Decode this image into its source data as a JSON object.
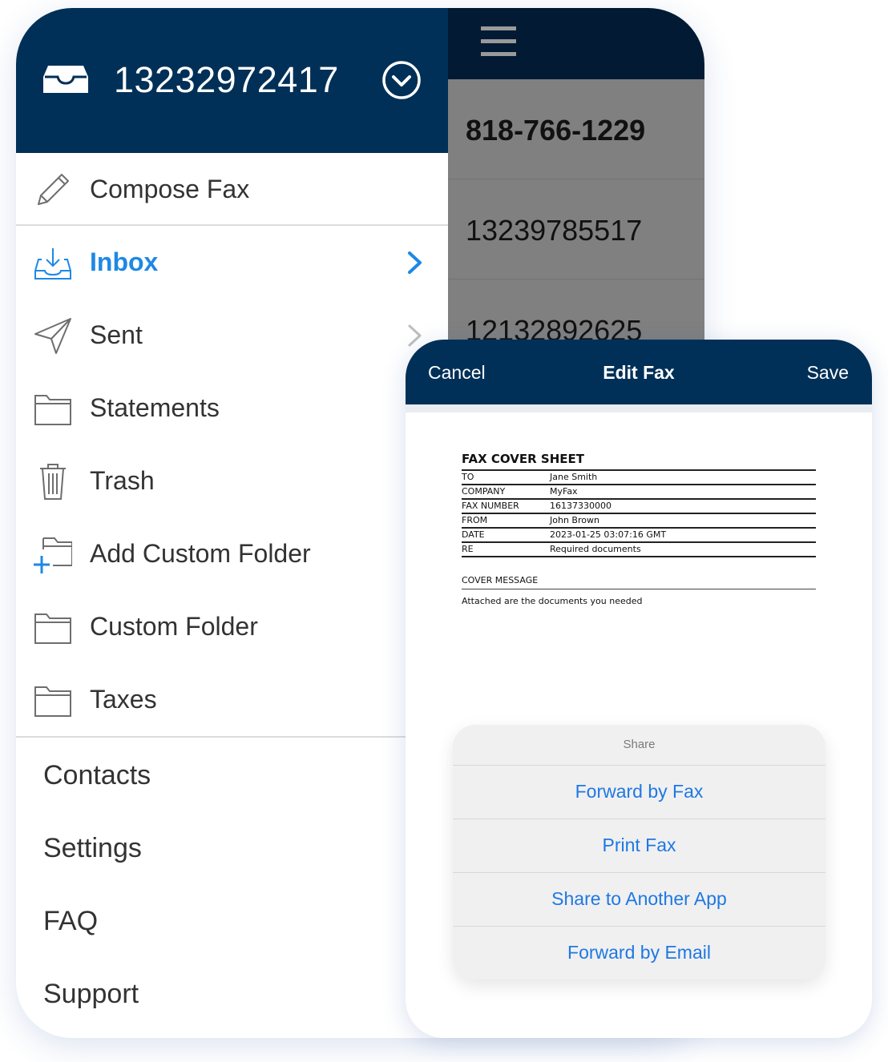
{
  "menu": {
    "account_number": "13232972417",
    "items": [
      {
        "label": "Compose Fax",
        "icon": "pencil-icon"
      },
      {
        "label": "Inbox",
        "icon": "inbox-download-icon",
        "active": true
      },
      {
        "label": "Sent",
        "icon": "paper-plane-icon"
      },
      {
        "label": "Statements",
        "icon": "folder-icon"
      },
      {
        "label": "Trash",
        "icon": "trash-icon"
      },
      {
        "label": "Add Custom Folder",
        "icon": "add-folder-icon"
      },
      {
        "label": "Custom Folder",
        "icon": "folder-icon"
      },
      {
        "label": "Taxes",
        "icon": "folder-icon"
      }
    ],
    "secondary": [
      "Contacts",
      "Settings",
      "FAQ",
      "Support"
    ]
  },
  "fax_list": [
    "818-766-1229",
    "13239785517",
    "12132892625"
  ],
  "edit_fax": {
    "cancel": "Cancel",
    "title": "Edit Fax",
    "save": "Save",
    "document": {
      "title": "FAX COVER SHEET",
      "rows": [
        {
          "key": "TO",
          "value": "Jane Smith"
        },
        {
          "key": "COMPANY",
          "value": "MyFax"
        },
        {
          "key": "FAX NUMBER",
          "value": "16137330000"
        },
        {
          "key": "FROM",
          "value": "John Brown"
        },
        {
          "key": "DATE",
          "value": "2023-01-25 03:07:16 GMT"
        },
        {
          "key": "RE",
          "value": "Required documents"
        }
      ],
      "cover_message_label": "COVER MESSAGE",
      "cover_message": "Attached are the documents you needed"
    },
    "share": {
      "title": "Share",
      "options": [
        "Forward by Fax",
        "Print Fax",
        "Share to Another App",
        "Forward by Email"
      ]
    }
  },
  "colors": {
    "header_navy": "#003057",
    "nav_dark": "#021a33",
    "list_gray": "#808080",
    "accent_blue": "#1e88e5",
    "link_blue": "#1e78e4"
  }
}
